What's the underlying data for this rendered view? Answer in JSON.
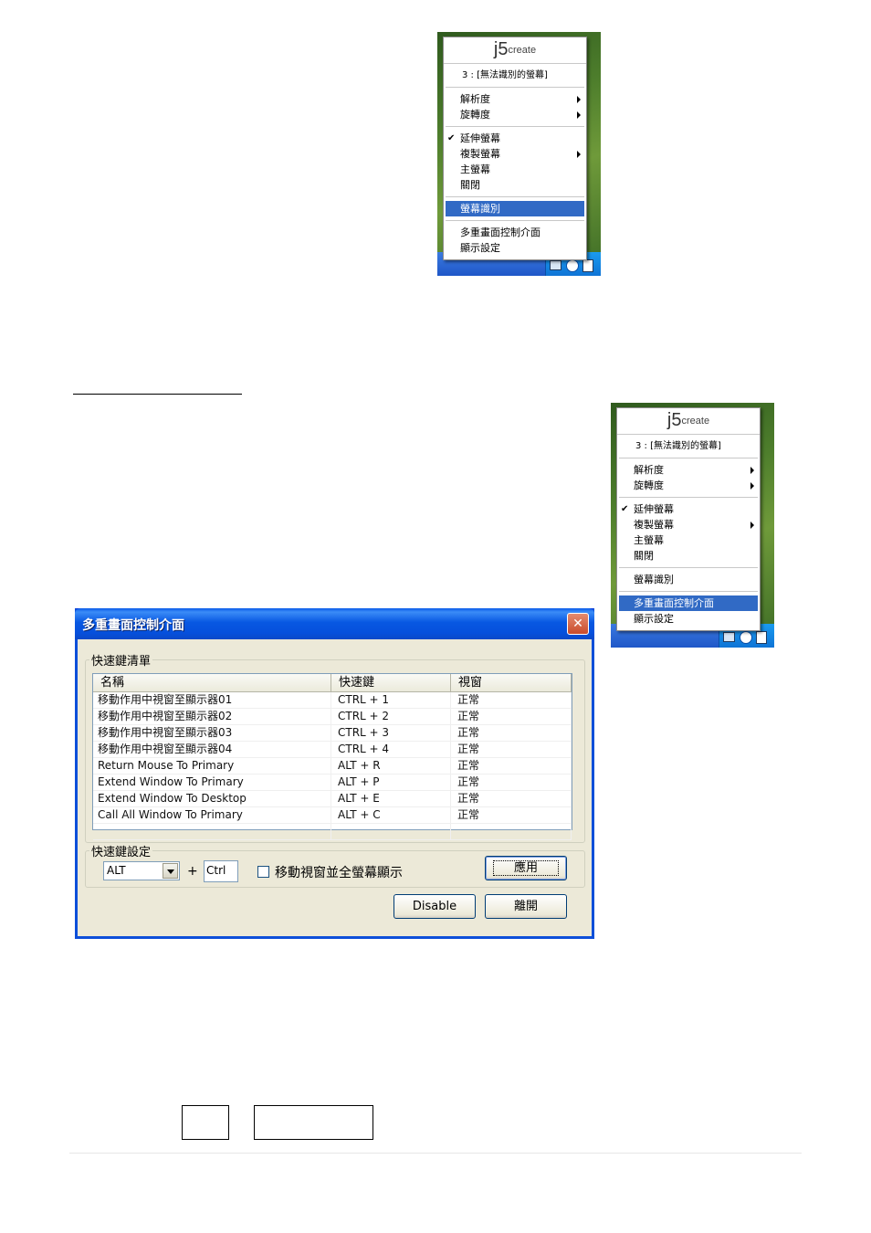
{
  "menu": {
    "logo_j5": "j5",
    "logo_create": "create",
    "header": "3 : [無法識別的螢幕]",
    "items": [
      {
        "label": "解析度",
        "submenu": true
      },
      {
        "label": "旋轉度",
        "submenu": true
      },
      {
        "label": "延伸螢幕",
        "checked": true
      },
      {
        "label": "複製螢幕",
        "submenu": true
      },
      {
        "label": "主螢幕"
      },
      {
        "label": "關閉"
      },
      {
        "label": "螢幕識別"
      },
      {
        "label": "多重畫面控制介面"
      },
      {
        "label": "顯示設定"
      }
    ],
    "selected_menu1": "螢幕識別",
    "selected_menu2": "多重畫面控制介面"
  },
  "dialog": {
    "title": "多重畫面控制介面",
    "close_glyph": "✕",
    "list_group_label": "快速鍵清單",
    "columns": [
      "名稱",
      "快速鍵",
      "視窗"
    ],
    "rows": [
      [
        "移動作用中視窗至顯示器01",
        "CTRL + 1",
        "正常"
      ],
      [
        "移動作用中視窗至顯示器02",
        "CTRL + 2",
        "正常"
      ],
      [
        "移動作用中視窗至顯示器03",
        "CTRL + 3",
        "正常"
      ],
      [
        "移動作用中視窗至顯示器04",
        "CTRL + 4",
        "正常"
      ],
      [
        "Return Mouse To Primary",
        "ALT + R",
        "正常"
      ],
      [
        "Extend Window To Primary",
        "ALT + P",
        "正常"
      ],
      [
        "Extend Window To Desktop",
        "ALT + E",
        "正常"
      ],
      [
        "Call All Window To Primary",
        "ALT + C",
        "正常"
      ]
    ],
    "settings_group_label": "快速鍵設定",
    "modifier_value": "ALT",
    "plus": "+",
    "key_value": "Ctrl",
    "fullscreen_checkbox_label": "移動視窗並全螢幕顯示",
    "apply_label": "應用",
    "disable_label": "Disable",
    "exit_label": "離開"
  },
  "colors": {
    "menu_highlight": "#316ac5",
    "title_bar": "#0858e2",
    "dialog_face": "#ece9d8"
  }
}
